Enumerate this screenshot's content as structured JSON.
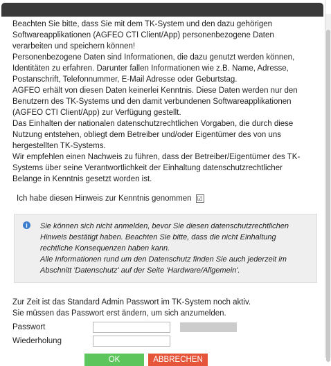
{
  "intro": {
    "lines": [
      "Beachten Sie bitte, dass Sie mit dem TK-System und den dazu gehörigen",
      "Softwareapplikationen (AGFEO CTI Client/App) personenbezogene Daten",
      "verarbeiten und speichern können!",
      "Personenbezogene Daten sind Informationen, die dazu genutzt werden können,",
      "Identitäten zu erfahren. Darunter fallen Informationen wie z.B. Name, Adresse,",
      "Postanschrift, Telefonnummer, E-Mail Adresse oder Geburtstag.",
      "AGFEO erhält von diesen Daten keinerlei Kenntnis. Diese Daten werden nur den",
      "Benutzern des TK-Systems und den damit verbundenen Softwareapplikationen",
      "(AGFEO CTI Client/App) zur Verfügung gestellt.",
      "Das Einhalten der nationalen datenschutzrechtlichen Vorgaben, die durch diese",
      "Nutzung entstehen, obliegt dem Betreiber und/oder Eigentümer des von uns",
      "hergestellten TK-Systems.",
      "Wir empfehlen einen Nachweis zu führen, dass der Betreiber/Eigentümer des TK-",
      "Systems über seine Verantwortlichkeit der Einhaltung datenschutzrechtlicher",
      "Belange in Kenntnis gesetzt worden ist."
    ]
  },
  "confirm": {
    "label": "Ich habe diesen Hinweis zur Kenntnis genommen",
    "checkmark": "☑",
    "checked": true
  },
  "info": {
    "icon": "info-icon",
    "icon_glyph": "i",
    "lines": [
      "Sie können sich nicht anmelden, bevor Sie diesen datenschutzrechtlichen",
      "Hinweis bestätigt haben. Beachten Sie bitte, dass die nicht Einhaltung",
      "rechtliche Konsequenzen haben kann.",
      "Alle Informationen rund um den Datenschutz finden Sie auch jederzeit im",
      "Abschnitt 'Datenschutz' auf der Seite 'Hardware/Allgemein'."
    ]
  },
  "password": {
    "notice_line1": "Zur Zeit ist das Standard Admin Passwort im TK-System noch aktiv.",
    "notice_line2": "Sie müssen das Passwort erst ändern, um sich anzumelden.",
    "password_label": "Passwort",
    "password_value": "",
    "repeat_label": "Wiederholung",
    "repeat_value": ""
  },
  "buttons": {
    "ok_label": "OK",
    "cancel_label": "ABBRECHEN"
  },
  "colors": {
    "titlebar": "#3a3a3a",
    "ok": "#5cc65c",
    "cancel": "#e6553a",
    "info_icon": "#3b7ed0",
    "info_background": "#efefef"
  }
}
